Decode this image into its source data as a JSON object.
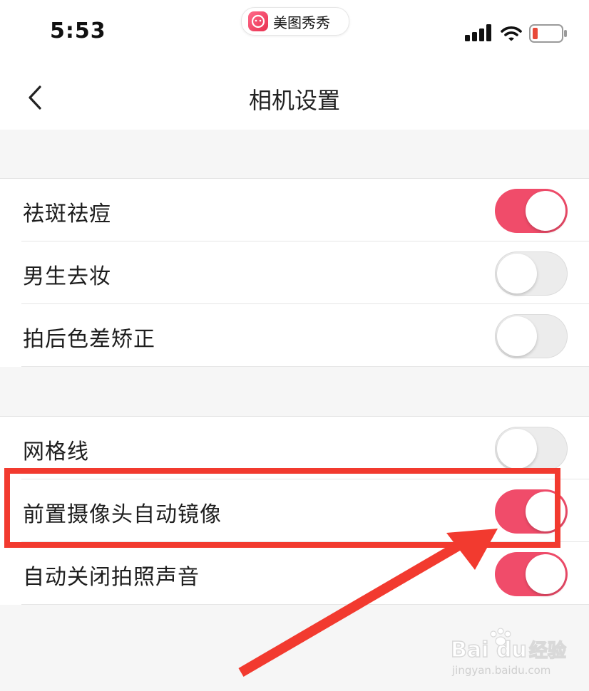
{
  "status_bar": {
    "time": "5:53",
    "app_name": "美图秀秀",
    "icons": [
      "meitu-app-icon",
      "signal-icon",
      "wifi-icon",
      "battery-icon"
    ],
    "battery_color": "#e84a3a"
  },
  "nav": {
    "title": "相机设置",
    "back_icon": "chevron-left-icon"
  },
  "groups": [
    {
      "items": [
        {
          "label": "祛斑祛痘",
          "on": true
        },
        {
          "label": "男生去妆",
          "on": false
        },
        {
          "label": "拍后色差矫正",
          "on": false
        }
      ]
    },
    {
      "items": [
        {
          "label": "网格线",
          "on": false
        },
        {
          "label": "前置摄像头自动镜像",
          "on": true
        },
        {
          "label": "自动关闭拍照声音",
          "on": true
        }
      ]
    }
  ],
  "annotation": {
    "highlighted_item": "前置摄像头自动镜像",
    "color": "#f23a2f"
  },
  "watermark": {
    "brand": "Bai",
    "brand_suffix": "du",
    "product": "经验",
    "url": "jingyan.baidu.com"
  },
  "colors": {
    "toggle_on": "#f04c6a",
    "toggle_off": "#ececec",
    "background": "#f6f6f6"
  }
}
